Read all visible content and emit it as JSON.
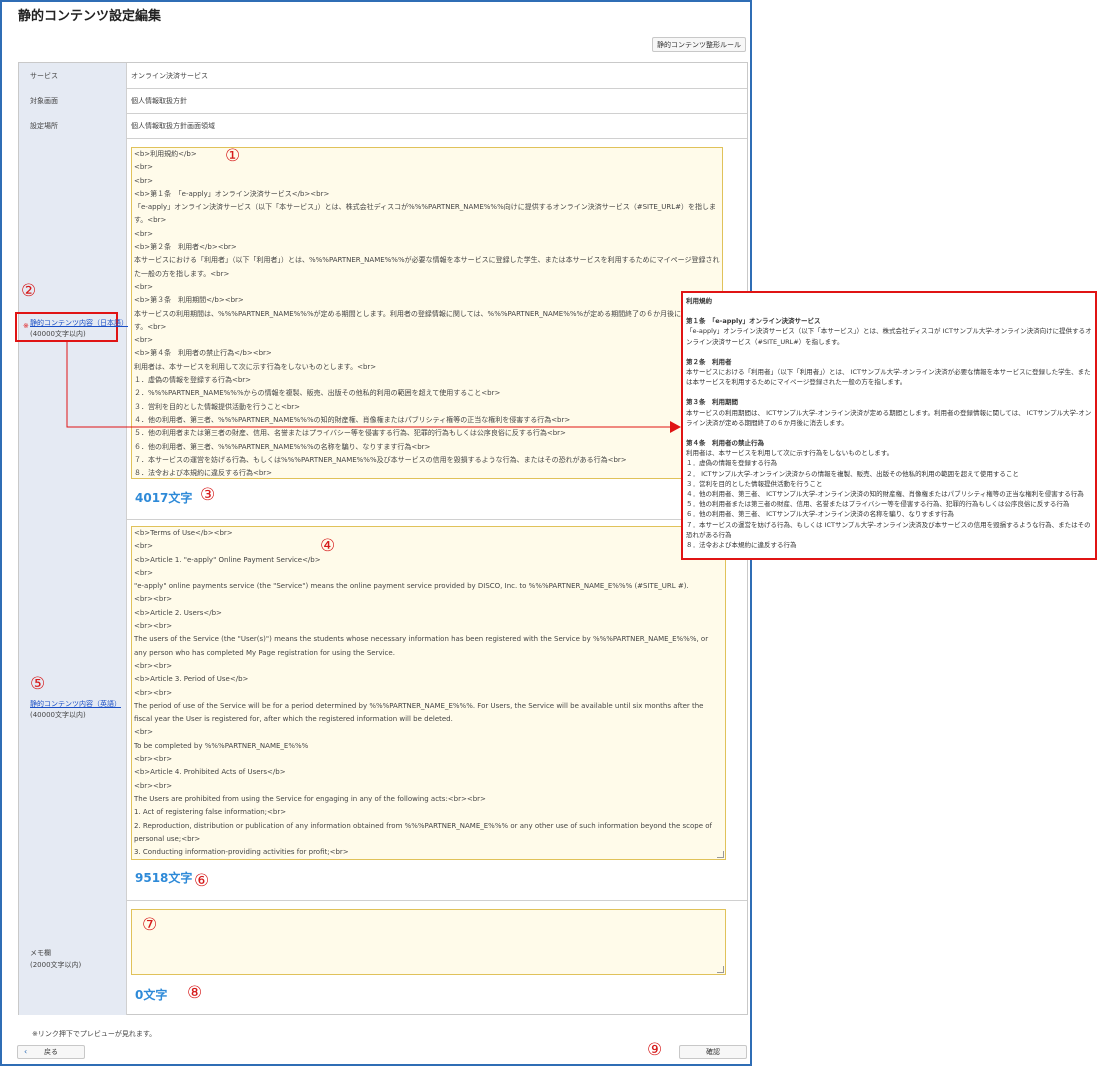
{
  "page": {
    "title": "静的コンテンツ設定編集",
    "rule_button": "静的コンテンツ整形ルール"
  },
  "fields": {
    "service_label": "サービス",
    "service_value": "オンライン決済サービス",
    "target_label": "対象画面",
    "target_value": "個人情報取扱方針",
    "place_label": "設定場所",
    "place_value": "個人情報取扱方針画面領域",
    "ja_label": "静的コンテンツ内容（日本語）",
    "ja_required": "※",
    "ja_limit": "(40000文字以内)",
    "en_label": "静的コンテンツ内容（英語）",
    "en_limit": "(40000文字以内)",
    "memo_label": "メモ欄",
    "memo_limit": "(2000文字以内)"
  },
  "ja_lines": [
    "<b>利用規約</b>",
    "<br>",
    "<br>",
    "<b>第１条　「e-apply」オンライン決済サービス</b><br>",
    "「e-apply」オンライン決済サービス（以下「本サービス」）とは、株式会社ディスコが%%%PARTNER_NAME%%%向けに提供するオンライン決済サービス（#SITE_URL#）を指します。<br>",
    "<br>",
    "<b>第２条　利用者</b><br>",
    "本サービスにおける「利用者」（以下「利用者」）とは、%%%PARTNER_NAME%%%が必要な情報を本サービスに登録した学生、または本サービスを利用するためにマイページ登録された一般の方を指します。<br>",
    "<br>",
    "<b>第３条　利用期間</b><br>",
    "本サービスの利用期間は、%%%PARTNER_NAME%%%が定める期間とします。利用者の登録情報に関しては、%%%PARTNER_NAME%%%が定める期間終了の６か月後に消去します。<br>",
    "<br>",
    "<b>第４条　利用者の禁止行為</b><br>",
    "利用者は、本サービスを利用して次に示す行為をしないものとします。<br>",
    "１．虚偽の情報を登録する行為<br>",
    "２．%%%PARTNER_NAME%%%からの情報を複製、販売、出版その他私的利用の範囲を超えて使用すること<br>",
    "３．営利を目的とした情報提供活動を行うこと<br>",
    "４．他の利用者、第三者、%%%PARTNER_NAME%%%の知的財産権、肖像権またはパブリシティ権等の正当な権利を侵害する行為<br>",
    "５．他の利用者または第三者の財産、信用、名誉またはプライバシー等を侵害する行為、犯罪的行為もしくは公序良俗に反する行為<br>",
    "６．他の利用者、第三者、%%%PARTNER_NAME%%%の名称を騙り、なりすます行為<br>",
    "７．本サービスの運営を妨げる行為、もしくは%%%PARTNER_NAME%%%及び本サービスの信用を毀損するような行為、またはその恐れがある行為<br>",
    "８．法令および本規約に違反する行為<br>"
  ],
  "en_lines": [
    "<b>Terms of Use</b><br>",
    "<br>",
    "<b>Article 1. \"e-apply\" Online Payment Service</b>",
    "<br>",
    "\"e-apply\" online payments service (the \"Service\") means the online payment service provided by DISCO, Inc. to %%%PARTNER_NAME_E%%% (#SITE_URL #).",
    "<br><br>",
    "<b>Article 2. Users</b>",
    "<br><br>",
    "The users of the Service (the \"User(s)\") means the students whose necessary information has been registered with the Service by %%%PARTNER_NAME_E%%%, or any person who has completed My Page registration for using the Service.",
    "<br><br>",
    "<b>Article 3. Period of Use</b>",
    "<br><br>",
    "The period of use of the Service will be for a period determined by %%%PARTNER_NAME_E%%%. For Users, the Service will be available until six months after the fiscal year the User is registered for, after which the registered information will be deleted.",
    "<br>",
    "To be completed by %%%PARTNER_NAME_E%%%",
    "<br><br>",
    "<b>Article 4. Prohibited Acts of Users</b>",
    "<br><br>",
    "The Users are prohibited from using the Service for engaging in any of the following acts:<br><br>",
    "1. Act of registering false information;<br>",
    "2. Reproduction, distribution or publication of any information obtained from %%%PARTNER_NAME_E%%% or any other use of such information beyond the scope of personal use;<br>",
    "3. Conducting information-providing activities for profit;<br>"
  ],
  "counts": {
    "ja": "4017文字",
    "en": "9518文字",
    "memo": "0文字"
  },
  "markers": {
    "m1": "①",
    "m2": "②",
    "m3": "③",
    "m4": "④",
    "m5": "⑤",
    "m6": "⑥",
    "m7": "⑦",
    "m8": "⑧",
    "m9": "⑨"
  },
  "footer": {
    "note": "※リンク押下でプレビューが見れます。",
    "back": "戻る",
    "back_arrow": "‹",
    "confirm": "確認"
  },
  "preview": {
    "title": "利用規約",
    "a1_title": "第１条　「e-apply」オンライン決済サービス",
    "a1_body": "「e-apply」オンライン決済サービス（以下「本サービス」）とは、株式会社ディスコが ICTサンプル大学-オンライン決済向けに提供するオンライン決済サービス（#SITE_URL#）を指します。",
    "a2_title": "第２条　利用者",
    "a2_body": "本サービスにおける「利用者」（以下「利用者」）とは、 ICTサンプル大学-オンライン決済が必要な情報を本サービスに登録した学生、または本サービスを利用するためにマイページ登録された一般の方を指します。",
    "a3_title": "第３条　利用期間",
    "a3_body": "本サービスの利用期間は、 ICTサンプル大学-オンライン決済が定める期間とします。利用者の登録情報に関しては、 ICTサンプル大学-オンライン決済が定める期間終了の６か月後に消去します。",
    "a4_title": "第４条　利用者の禁止行為",
    "a4_body": "利用者は、本サービスを利用して次に示す行為をしないものとします。",
    "items": [
      "１．虚偽の情報を登録する行為",
      "２． ICTサンプル大学-オンライン決済からの情報を複製、販売、出版その他私的利用の範囲を超えて使用すること",
      "３．営利を目的とした情報提供活動を行うこと",
      "４．他の利用者、第三者、 ICTサンプル大学-オンライン決済の知的財産権、肖像権またはパブリシティ権等の正当な権利を侵害する行為",
      "５．他の利用者または第三者の財産、信用、名誉またはプライバシー等を侵害する行為、犯罪的行為もしくは公序良俗に反する行為",
      "６．他の利用者、第三者、 ICTサンプル大学-オンライン決済の名称を騙り、なりすます行為",
      "７．本サービスの運営を妨げる行為、もしくは ICTサンプル大学-オンライン決済及び本サービスの信用を毀損するような行為、またはその恐れがある行為",
      "８．法令および本規約に違反する行為"
    ]
  },
  "colors": {
    "frame": "#2f6db5",
    "accent_red": "#e01414",
    "count_blue": "#2e8ad8",
    "label_bg": "#e5eaf3",
    "textarea_bg": "#fffbea",
    "textarea_border": "#e0c25a"
  }
}
